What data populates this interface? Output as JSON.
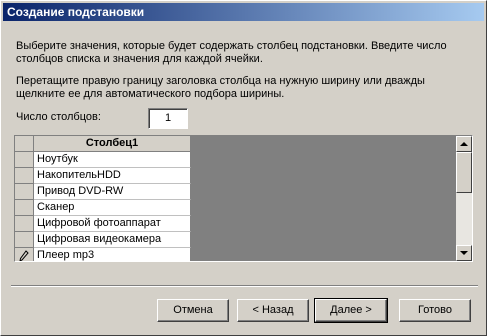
{
  "window": {
    "title": "Создание подстановки"
  },
  "instructions": {
    "line1": "Выберите значения, которые будет содержать столбец подстановки. Введите число",
    "line2": "столбцов списка и значения для каждой ячейки.",
    "line3": "Перетащите правую границу заголовка столбца на нужную ширину или дважды",
    "line4": "щелкните ее для автоматического подбора ширины."
  },
  "columns_count": {
    "label": "Число столбцов:",
    "value": "1"
  },
  "grid": {
    "header": "Столбец1",
    "rows": [
      {
        "value": "Ноутбук",
        "selector": ""
      },
      {
        "value": "НакопительHDD",
        "selector": ""
      },
      {
        "value": "Привод DVD-RW",
        "selector": ""
      },
      {
        "value": "Сканер",
        "selector": ""
      },
      {
        "value": "Цифровой фотоаппарат",
        "selector": ""
      },
      {
        "value": "Цифровая видеокамера",
        "selector": ""
      },
      {
        "value": "Плеер mp3",
        "selector": "pencil-icon"
      },
      {
        "value": "",
        "selector": "new-row-icon"
      }
    ]
  },
  "buttons": {
    "cancel": "Отмена",
    "back": "< Назад",
    "next": "Далее >",
    "finish": "Готово"
  },
  "colors": {
    "title_start": "#0a246a",
    "title_end": "#a6caf0",
    "face": "#d4d0c8"
  }
}
